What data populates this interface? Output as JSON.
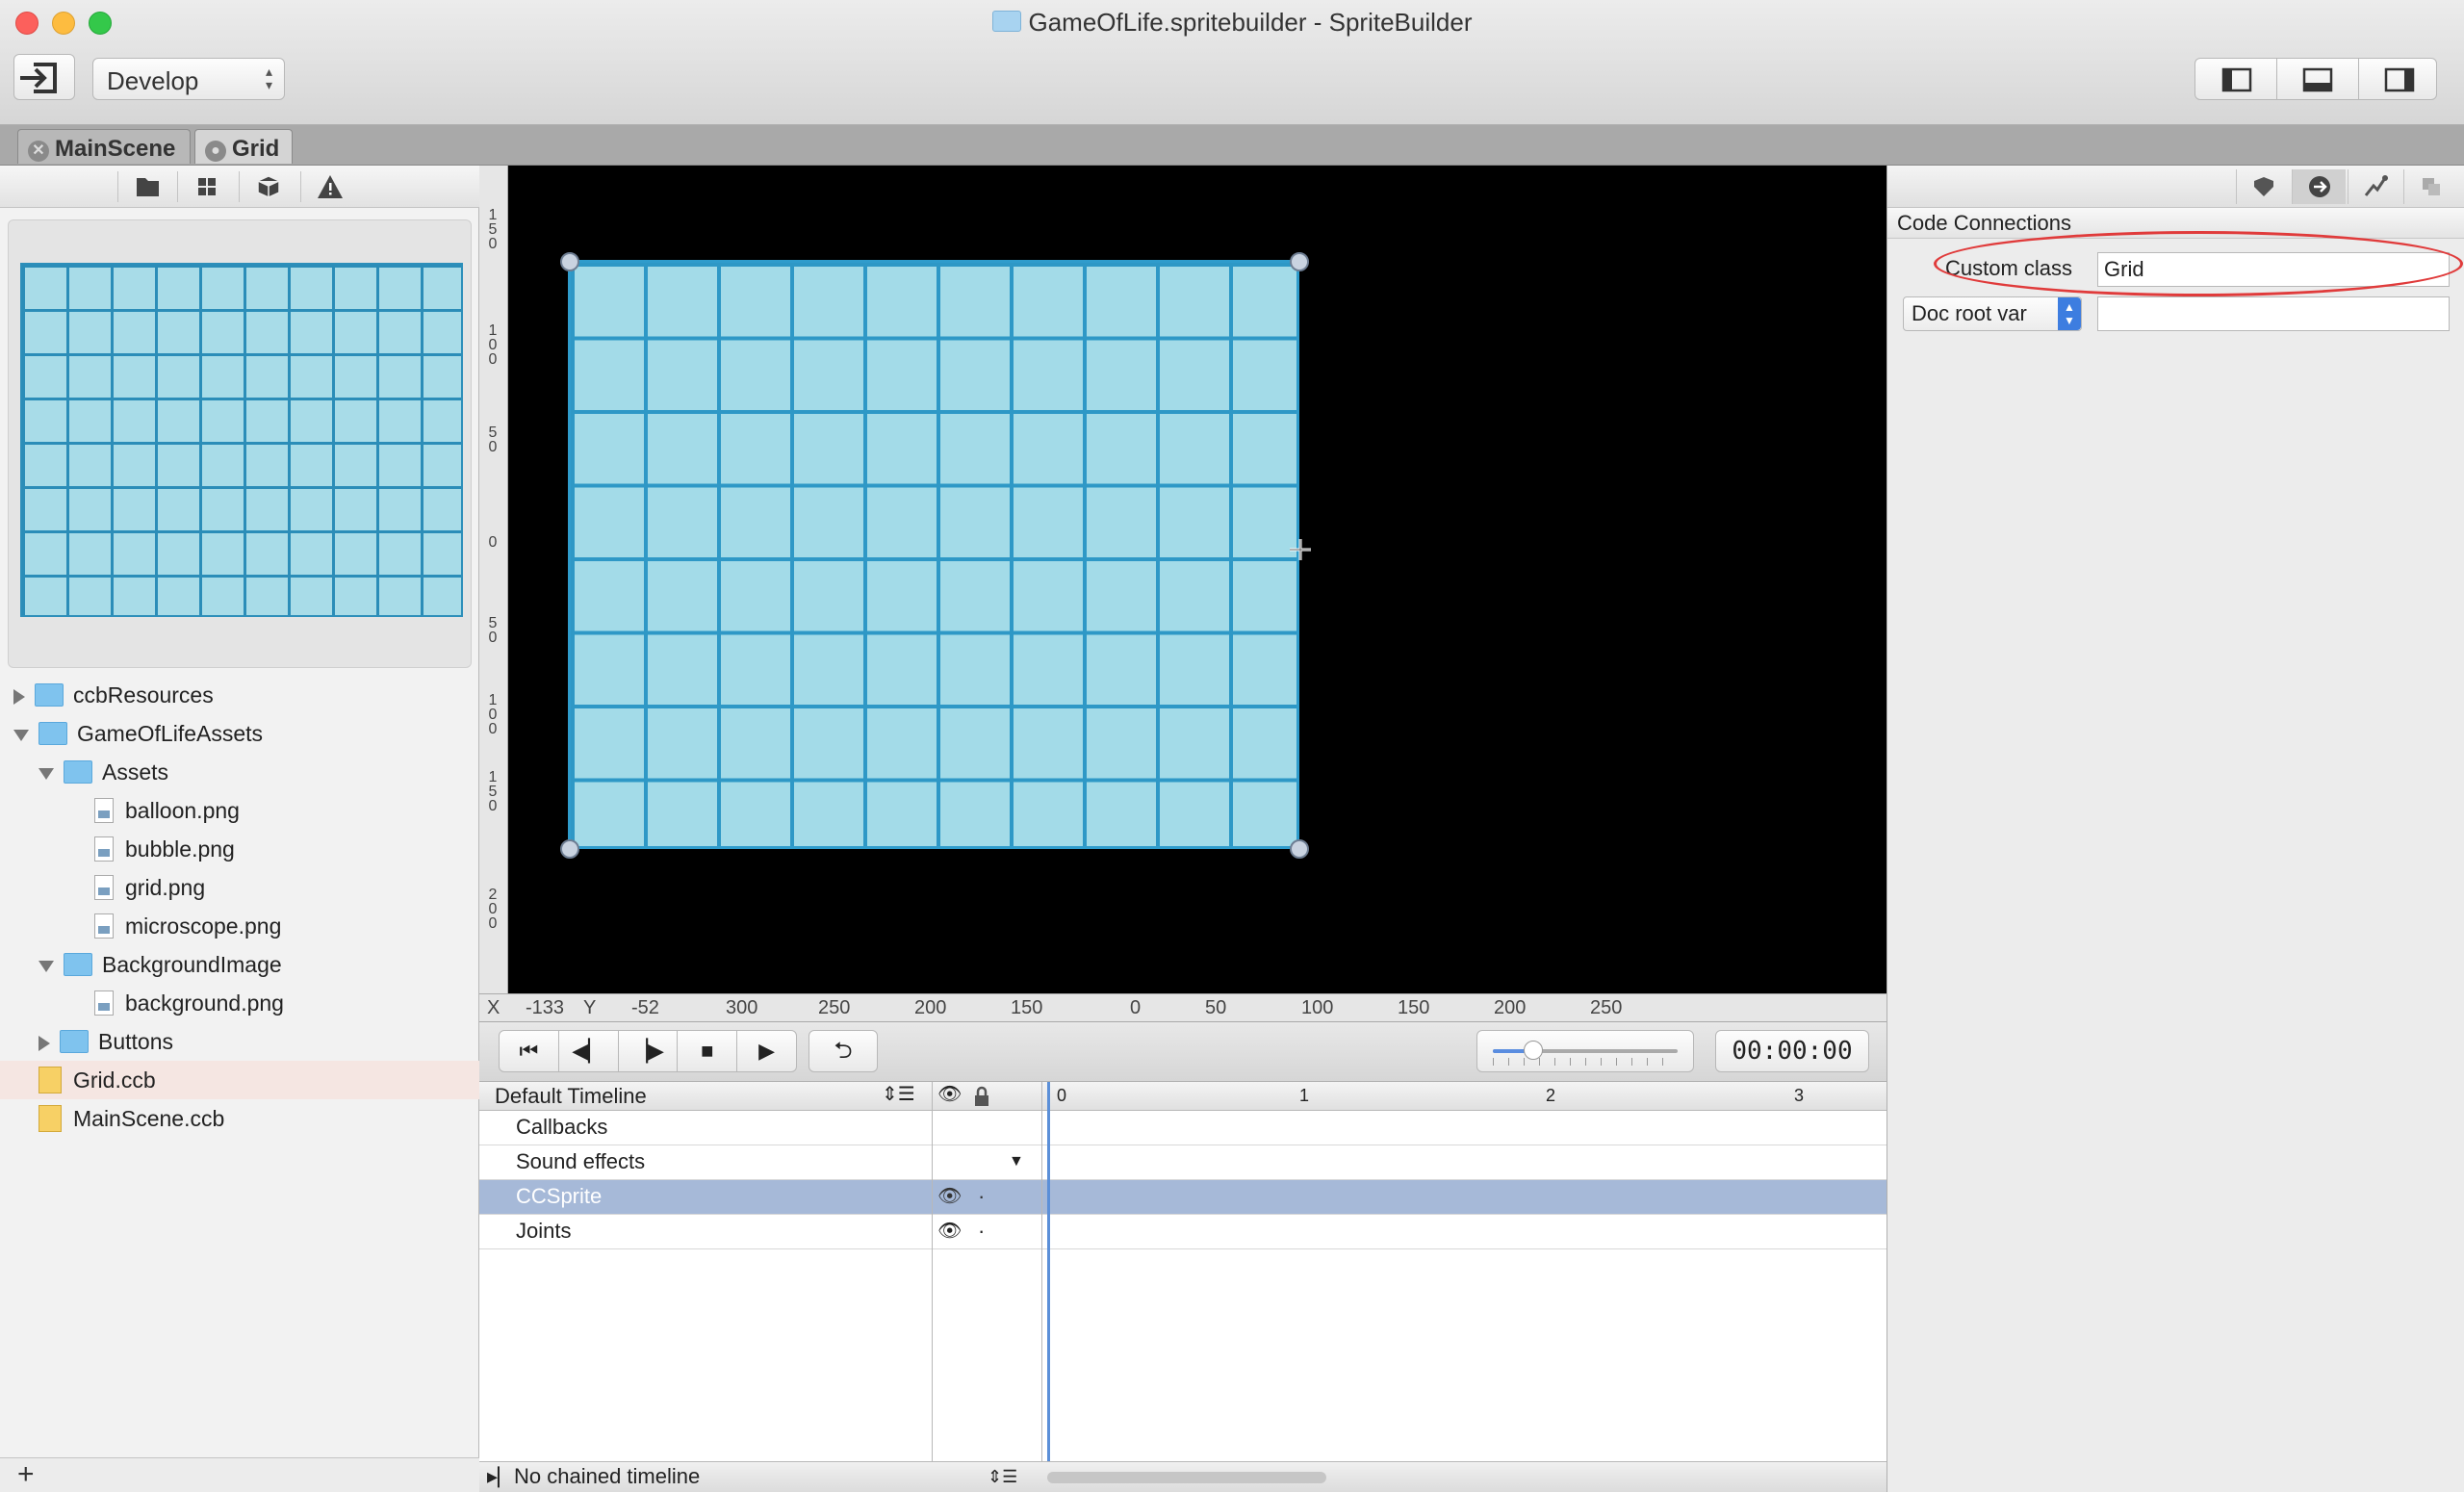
{
  "window": {
    "title": "GameOfLife.spritebuilder - SpriteBuilder"
  },
  "toolbar": {
    "mode_select": "Develop"
  },
  "tabs": [
    {
      "label": "MainScene"
    },
    {
      "label": "Grid"
    }
  ],
  "project_tree": [
    {
      "label": "ccbResources"
    },
    {
      "label": "GameOfLifeAssets"
    },
    {
      "label": "Assets"
    },
    {
      "label": "balloon.png"
    },
    {
      "label": "bubble.png"
    },
    {
      "label": "grid.png"
    },
    {
      "label": "microscope.png"
    },
    {
      "label": "BackgroundImage"
    },
    {
      "label": "background.png"
    },
    {
      "label": "Buttons"
    },
    {
      "label": "Grid.ccb"
    },
    {
      "label": "MainScene.ccb"
    }
  ],
  "ruler": {
    "vertical": [
      "150",
      "100",
      "50",
      "0",
      "50",
      "100",
      "150",
      "200"
    ],
    "horizontal": [
      "300",
      "250",
      "200",
      "150",
      "0",
      "50",
      "100",
      "150",
      "200",
      "250"
    ],
    "x_label": "X",
    "x_value": "-133",
    "y_label": "Y",
    "y_value": "-52"
  },
  "playback": {
    "time": "00:00:00",
    "scale_fraction": 0.22
  },
  "timeline": {
    "name": "Default Timeline",
    "ticks": [
      "0",
      "1",
      "2",
      "3"
    ],
    "rows": [
      {
        "label": "Callbacks"
      },
      {
        "label": "Sound effects"
      },
      {
        "label": "CCSprite"
      },
      {
        "label": "Joints"
      }
    ],
    "chained": "No chained timeline"
  },
  "inspector": {
    "section_title": "Code Connections",
    "custom_class_label": "Custom class",
    "custom_class_value": "Grid",
    "doc_root_var_label": "Doc root var",
    "doc_root_var_value": ""
  },
  "colors": {
    "annotation": "#e03b3b",
    "selection": "#a6b9d8",
    "sprite_cell": "#a3dbe8"
  }
}
